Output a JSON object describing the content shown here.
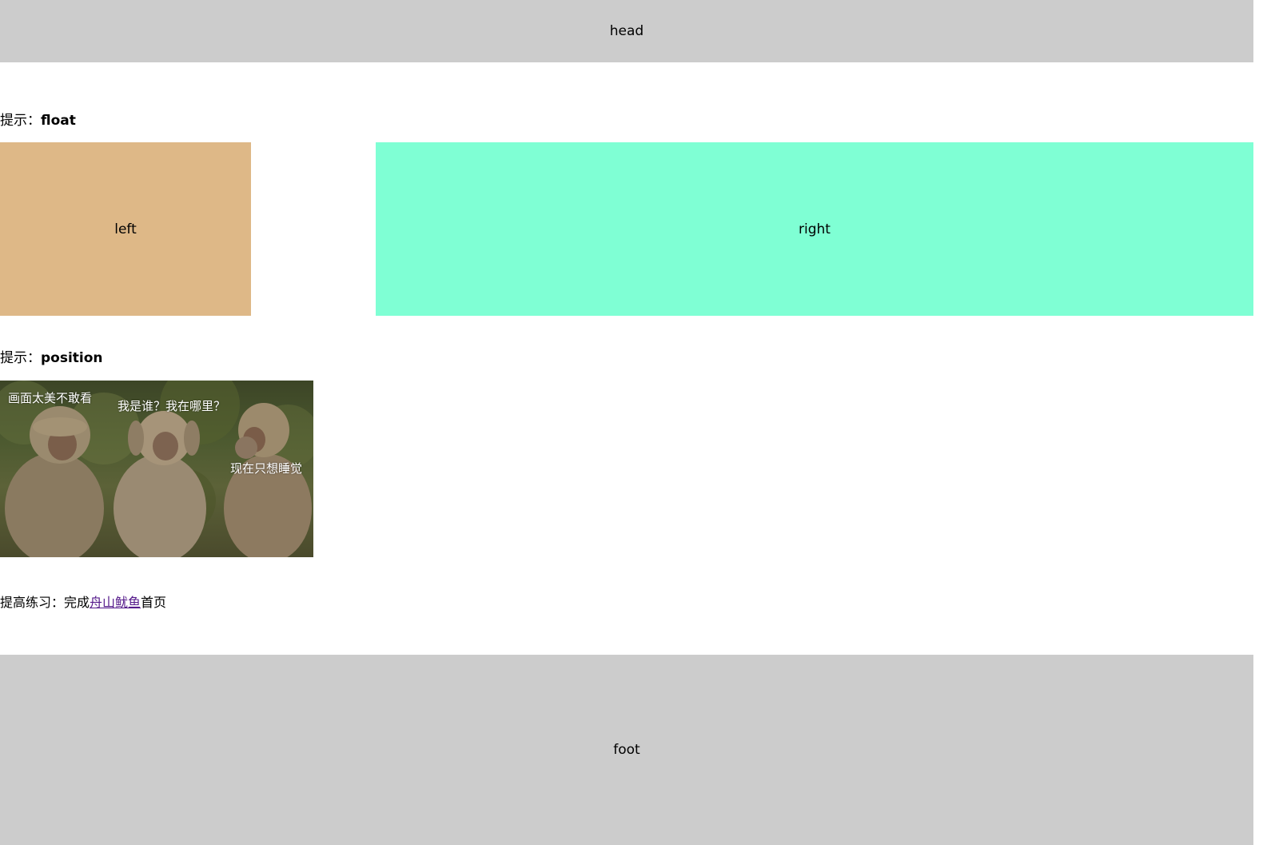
{
  "header": {
    "label": "head"
  },
  "float_hint": {
    "prefix": "提示：",
    "keyword": "float"
  },
  "float_boxes": {
    "left_label": "left",
    "right_label": "right"
  },
  "position_hint": {
    "prefix": "提示：",
    "keyword": "position"
  },
  "photo": {
    "captions": [
      "画面太美不敢看",
      "我是谁？我在哪里？",
      "现在只想睡觉"
    ]
  },
  "practice": {
    "prefix": "提高练习：完成",
    "link_text": "舟山鱿鱼",
    "suffix": "首页"
  },
  "footer": {
    "label": "foot"
  },
  "colors": {
    "head_bg": "#cccccc",
    "left_bg": "#deb887",
    "right_bg": "#7fffd4",
    "foot_bg": "#cccccc",
    "link": "#551a8b"
  }
}
